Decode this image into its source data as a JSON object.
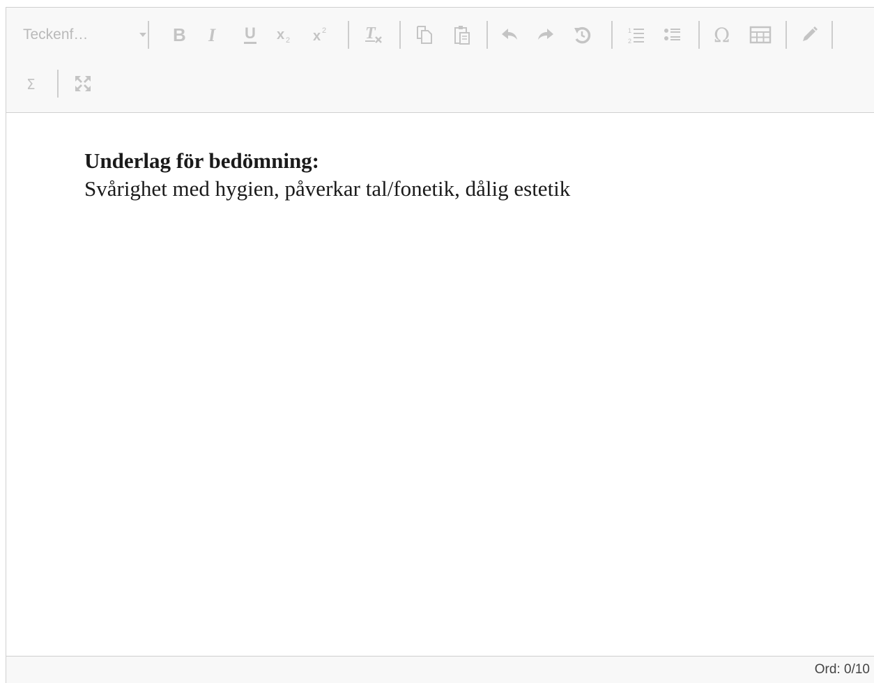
{
  "toolbar": {
    "font_combo": "Teckenf…",
    "buttons": [
      {
        "name": "bold",
        "icon": "bold-icon"
      },
      {
        "name": "italic",
        "icon": "italic-icon"
      },
      {
        "name": "underline",
        "icon": "underline-icon"
      },
      {
        "name": "subscript",
        "icon": "subscript-icon"
      },
      {
        "name": "superscript",
        "icon": "superscript-icon"
      },
      {
        "name": "remove-format",
        "icon": "remove-format-icon"
      },
      {
        "name": "copy",
        "icon": "copy-icon"
      },
      {
        "name": "paste",
        "icon": "paste-icon"
      },
      {
        "name": "undo",
        "icon": "undo-icon"
      },
      {
        "name": "redo",
        "icon": "redo-icon"
      },
      {
        "name": "reset",
        "icon": "reset-icon"
      },
      {
        "name": "numbered-list",
        "icon": "numbered-list-icon"
      },
      {
        "name": "bulleted-list",
        "icon": "bulleted-list-icon"
      },
      {
        "name": "special-character",
        "icon": "omega-icon"
      },
      {
        "name": "table",
        "icon": "table-icon"
      },
      {
        "name": "draw",
        "icon": "pencil-icon"
      },
      {
        "name": "math",
        "icon": "sigma-icon"
      },
      {
        "name": "fullscreen",
        "icon": "fullscreen-icon"
      }
    ],
    "subscript_mark": "2",
    "superscript_mark": "2",
    "sigma_glyph": "Σ",
    "omega_glyph": "Ω"
  },
  "content": {
    "label": "Underlag för bedömning:",
    "text": "Svårighet med hygien, påverkar tal/fonetik, dålig estetik"
  },
  "status": {
    "word_count": "Ord: 0/10"
  },
  "colors": {
    "toolbar_bg": "#f8f8f8",
    "icon_color": "#c4c4c4",
    "border": "#cfcfcf",
    "text": "#1a1a1a"
  }
}
